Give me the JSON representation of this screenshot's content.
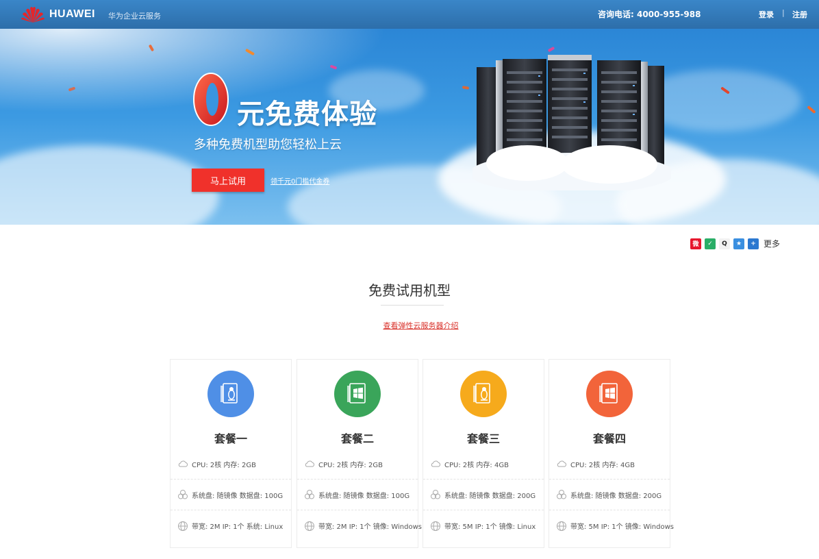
{
  "header": {
    "brand": "HUAWEI",
    "brand_sub": "华为企业云服务",
    "hotline": "咨询电话: 4000-955-988",
    "login": "登录",
    "divider": "|",
    "register": "注册"
  },
  "banner": {
    "headline": "元免费体验",
    "subline": "多种免费机型助您轻松上云",
    "try_button": "马上试用",
    "coupon_link": "领千元0门槛代金券",
    "accent_color": "#f0312b"
  },
  "share": {
    "icons": [
      "weibo-icon",
      "wechat-icon",
      "qq-icon",
      "qzone-icon",
      "share-plus-icon"
    ],
    "more_label": "更多"
  },
  "section": {
    "title": "免费试用机型",
    "link": "查看弹性云服务器介绍"
  },
  "plans": [
    {
      "name": "套餐一",
      "color": "#4f8fe6",
      "os_icon": "linux-icon",
      "spec": "CPU: 2核  内存: 2GB",
      "disk": "系统盘: 随镜像  数据盘: 100G",
      "net": "带宽: 2M  IP: 1个  系统: Linux"
    },
    {
      "name": "套餐二",
      "color": "#3aa55a",
      "os_icon": "windows-icon",
      "spec": "CPU: 2核  内存: 2GB",
      "disk": "系统盘: 随镜像  数据盘: 100G",
      "net": "带宽: 2M  IP: 1个  镜像: Windows"
    },
    {
      "name": "套餐三",
      "color": "#f6aa1c",
      "os_icon": "linux-icon",
      "spec": "CPU: 2核  内存: 4GB",
      "disk": "系统盘: 随镜像  数据盘: 200G",
      "net": "带宽: 5M  IP: 1个  镜像: Linux"
    },
    {
      "name": "套餐四",
      "color": "#f2643a",
      "os_icon": "windows-icon",
      "spec": "CPU: 2核  内存: 4GB",
      "disk": "系统盘: 随镜像  数据盘: 200G",
      "net": "带宽: 5M  IP: 1个  镜像: Windows"
    }
  ]
}
